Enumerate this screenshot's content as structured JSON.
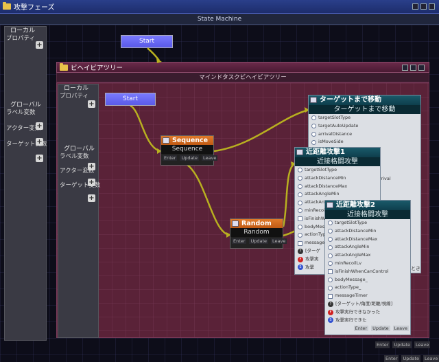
{
  "window": {
    "title": "攻撃フェーズ"
  },
  "state_machine": {
    "header": "State Machine",
    "start_label": "Start",
    "panel": {
      "local_label": "ローカル",
      "property_label": "プロパティ",
      "global_label": "グローバル",
      "label_var": "ラベル変数",
      "actor_var": "アクター変数",
      "target_var": "ターゲット変数"
    },
    "footer": [
      "Enter",
      "Update",
      "Leave"
    ]
  },
  "behavior_tree": {
    "title": "ビヘイビアツリー",
    "header": "マインドタスクビヘイビアツリー",
    "start_label": "Start",
    "panel": {
      "local_label": "ローカル",
      "property_label": "プロパティ",
      "global_label": "グローバル",
      "label_var": "ラベル変数",
      "actor_var": "アクター変数",
      "target_var": "ターゲット変数"
    },
    "sequence": {
      "title": "Sequence",
      "subtitle": "Sequence",
      "footer": [
        "Enter",
        "Update",
        "Leave"
      ]
    },
    "random": {
      "title": "Random",
      "subtitle": "Random",
      "footer": [
        "Enter",
        "Update",
        "Leave"
      ]
    },
    "move_task": {
      "title": "ターゲットまで移動",
      "subtitle": "ターゲットまで移動",
      "rows": [
        "targetSlotType",
        "targetAutoUpdate",
        "arrivalDistance",
        "isMoveSide"
      ],
      "side_text": "rrival"
    },
    "melee1": {
      "title": "近距離攻撃1",
      "subtitle": "近接格闘攻撃",
      "rows": [
        "targetSlotType",
        "attackDistanceMin",
        "attackDistanceMax",
        "attackAngleMin",
        "attackAngleMax",
        "minRecoilLv",
        "isFinishWhenCanControl",
        "bodyMessage_",
        "actionType_",
        "messageTimer"
      ],
      "extra": [
        "[ターゲ",
        "攻撃実",
        "攻撃"
      ],
      "side_text": "とき"
    },
    "melee2": {
      "title": "近距離攻撃2",
      "subtitle": "近接格闘攻撃",
      "rows": [
        "targetSlotType",
        "attackDistanceMin",
        "attackDistanceMax",
        "attackAngleMin",
        "attackAngleMax",
        "minRecoilLv",
        "isFinishWhenCanControl",
        "bodyMessage_",
        "actionType_",
        "messageTimer"
      ],
      "extra": [
        "[ターゲット/角度/距離/視線]",
        "攻撃実行できなかった",
        "攻撃実行できた"
      ],
      "footer": [
        "Enter",
        "Update",
        "Leave"
      ]
    },
    "footer": [
      "Enter",
      "Update",
      "Leave"
    ]
  },
  "colors": {
    "accent_start": "#6a6af4",
    "composite": "#d0661e",
    "task_title": "#14495a",
    "link": "#b8b020"
  }
}
